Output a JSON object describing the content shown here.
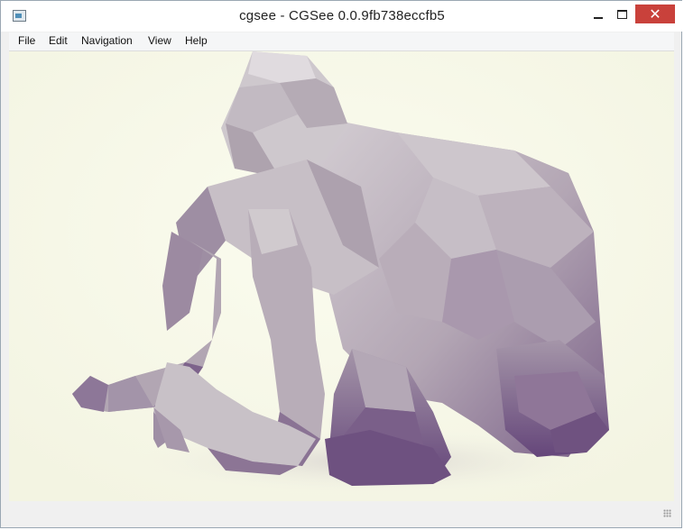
{
  "window": {
    "title": "cgsee - CGSee 0.0.9fb738eccfb5"
  },
  "menu": {
    "items": [
      "File",
      "Edit",
      "Navigation",
      "View",
      "Help"
    ]
  },
  "controls": {
    "minimize_icon": "minimize-icon",
    "maximize_icon": "maximize-icon",
    "close_icon": "close-icon",
    "close_glyph": "✕"
  },
  "colors": {
    "close": "#c9413b",
    "background": "#f8f9ea",
    "model": "#b8aeb7",
    "shadow": "#6d4a79"
  },
  "scene": {
    "model": "low-poly mammoth"
  }
}
